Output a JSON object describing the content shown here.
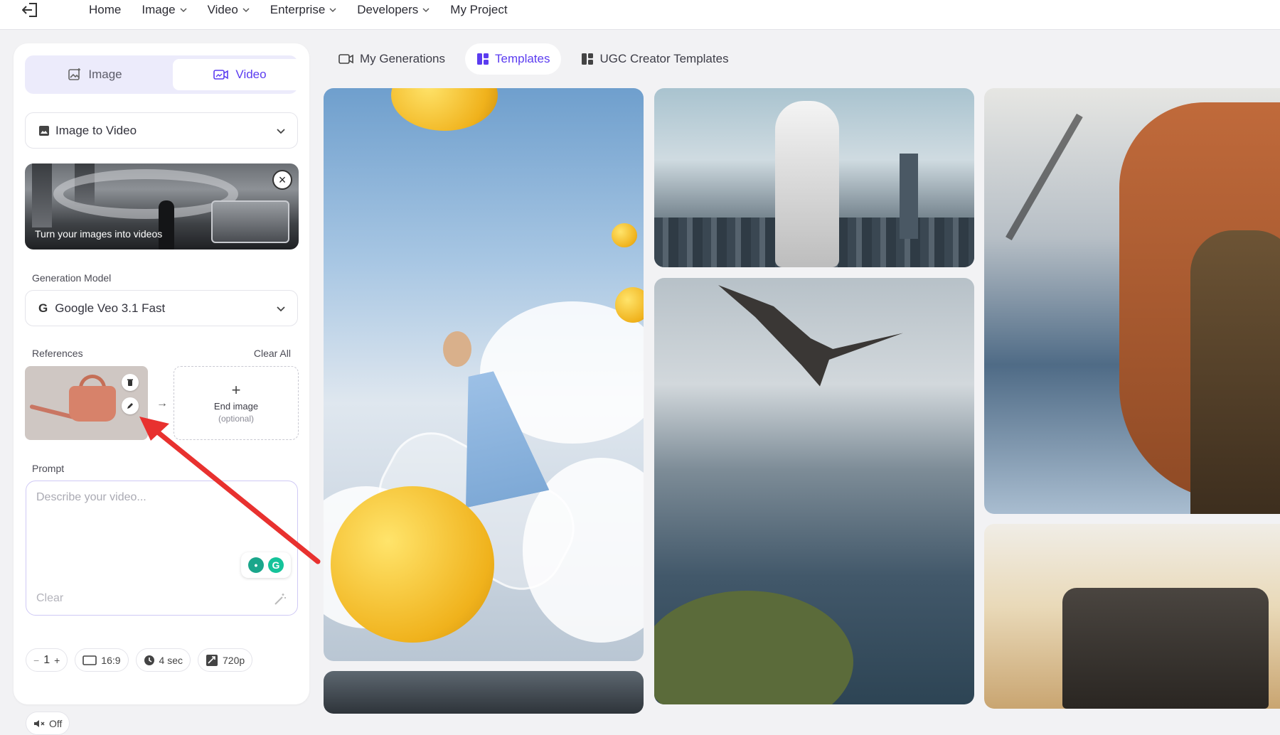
{
  "nav": {
    "items": [
      {
        "label": "Home",
        "has_menu": false
      },
      {
        "label": "Image",
        "has_menu": true
      },
      {
        "label": "Video",
        "has_menu": true
      },
      {
        "label": "Enterprise",
        "has_menu": true
      },
      {
        "label": "Developers",
        "has_menu": true
      },
      {
        "label": "My Project",
        "has_menu": false
      }
    ]
  },
  "sidebar": {
    "mode_image": "Image",
    "mode_video": "Video",
    "active_mode": "Video",
    "workflow": "Image to Video",
    "banner_text": "Turn your images into videos",
    "generation_model_label": "Generation Model",
    "generation_model": "Google Veo 3.1 Fast",
    "references_label": "References",
    "clear_all": "Clear All",
    "end_image_title": "End image",
    "end_image_sub": "(optional)",
    "prompt_label": "Prompt",
    "prompt_placeholder": "Describe your video...",
    "prompt_value": "",
    "prompt_clear": "Clear",
    "count": "1",
    "aspect": "16:9",
    "duration": "4 sec",
    "resolution": "720p",
    "audio": "Off"
  },
  "tabs": [
    {
      "label": "My Generations",
      "icon": "gallery-icon",
      "active": false
    },
    {
      "label": "Templates",
      "icon": "templates-icon",
      "active": true
    },
    {
      "label": "UGC Creator Templates",
      "icon": "ugc-templates-icon",
      "active": false
    }
  ],
  "colors": {
    "accent": "#5b3cf0",
    "accent_bg": "#ecebfb",
    "annotation_arrow": "#e8312f"
  }
}
